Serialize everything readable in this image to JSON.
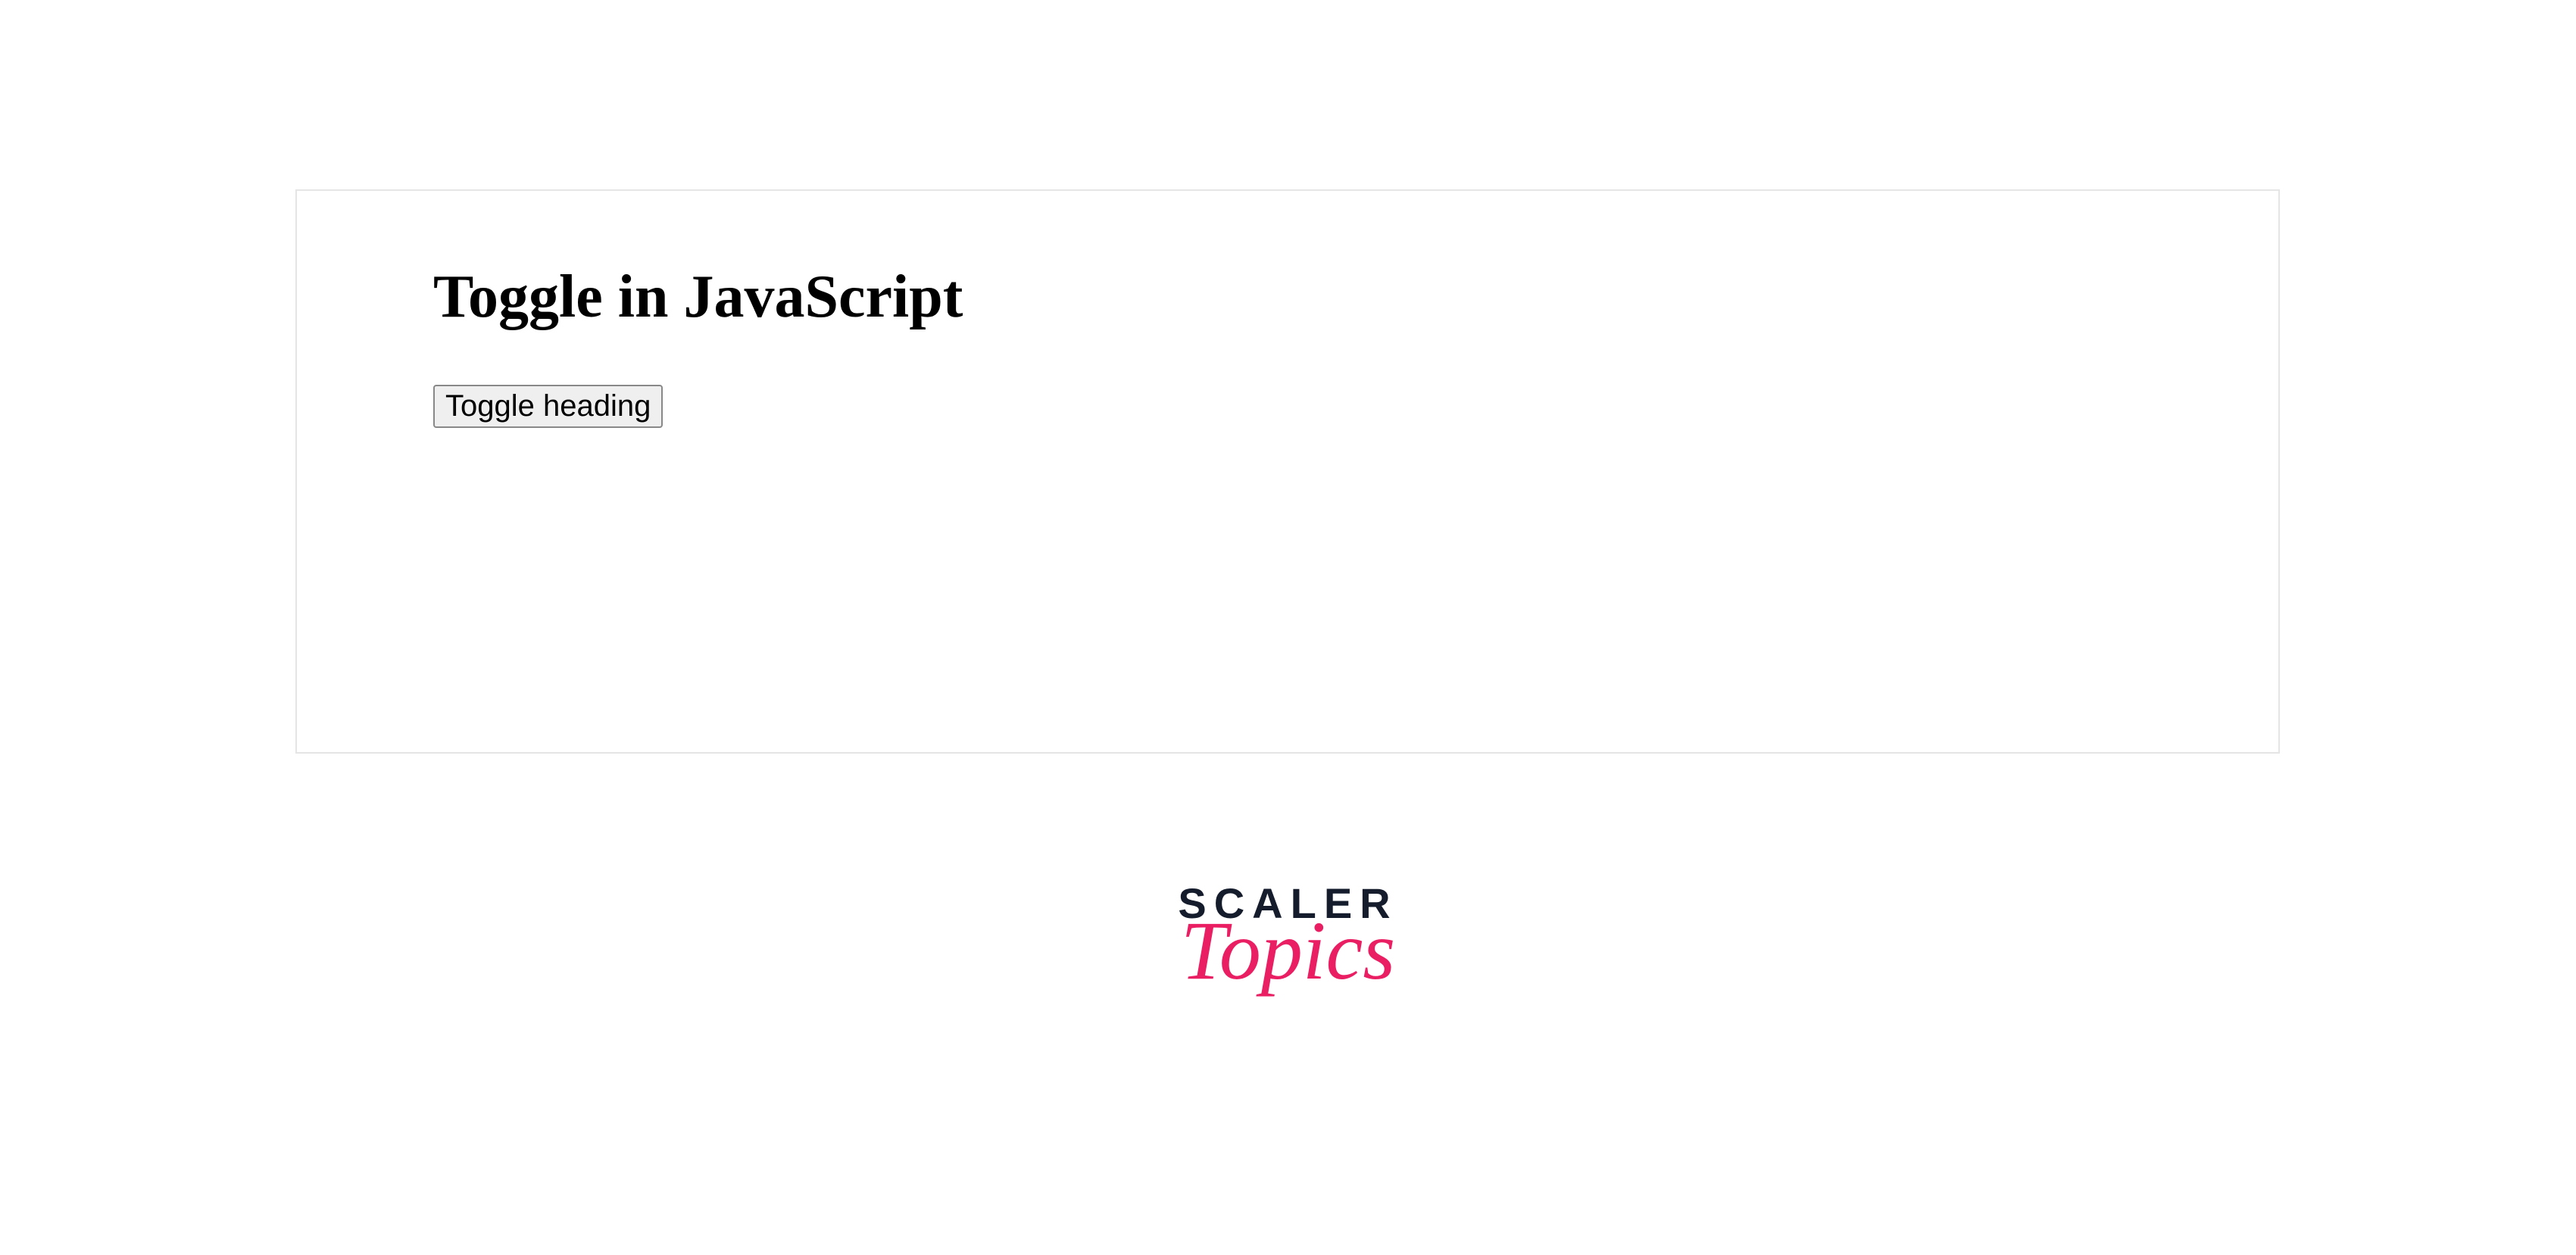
{
  "page": {
    "heading": "Toggle in JavaScript",
    "button_label": "Toggle heading"
  },
  "logo": {
    "line1": "SCALER",
    "line2": "Topics"
  }
}
